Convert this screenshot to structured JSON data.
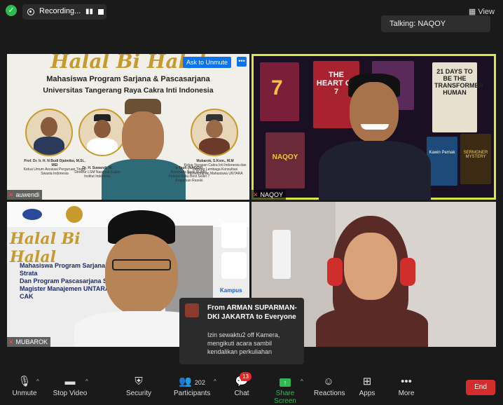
{
  "top": {
    "recording_label": "Recording...",
    "view_label": "View",
    "talking": "Talking: NAQOY"
  },
  "tiles": [
    {
      "name": "auwendi",
      "banner_title": "Halal Bi Halal",
      "subtitle_1": "Mahasiswa Program Sarjana & Pascasarjana",
      "subtitle_2": "Universitas Tangerang Raya Cakra Inti Indonesia",
      "ask_unmute": "Ask to Unmute",
      "more": "•••",
      "speakers": [
        {
          "name": "Prof. Dr. Ir. H. N Budi Djatmiko, M.Si., MEI",
          "desc": "Ketua Umum Asosiasi Perguruan Tinggi Swasta Indonesia"
        },
        {
          "name": "Dr. H. Suwandi, M.",
          "desc": "Direktur LSM Nasional Kajian Institut Indonesia"
        },
        {
          "name": "n Taufi (NAQOY)",
          "desc": "Komisaris Bank BUMN, Penulis Buku Best Seller 7 Keajaiban Rezeki"
        },
        {
          "name": "Mubarok, S.Kom., M.M",
          "desc": "Ketua Yayasan Cakra Inti Indonesia dan Direktur Lembaga Konsultasi Pemerintahan Mahasiswa UNTARA"
        }
      ]
    },
    {
      "name": "NAQOY",
      "books": [
        "7",
        "THE HEART OF 7",
        "21 DAYS TO BE THE TRANSFORMER HUMAN",
        "NAQOY",
        "Kawin Pernak",
        "SERMONER MYSTERY"
      ]
    },
    {
      "name": "MUBAROK",
      "banner_title": "Halal Bi Halal",
      "lines": [
        "Mahasiswa Program Sarjana Strata",
        "Dan Program Pascasarjana Strata",
        "Magister Manajemen UNTARA-CAK"
      ],
      "kampus": "Kampus"
    },
    {
      "name": ""
    }
  ],
  "chat": {
    "from": "From ARMAN SUPARMAN-DKI JAKARTA to Everyone",
    "message": "Izin sewaktu2 off Kamera, mengikuti acara sambil kendalikan perkuliahan"
  },
  "toolbar": {
    "unmute": "Unmute",
    "stop_video": "Stop Video",
    "security": "Security",
    "participants": "Participants",
    "participants_count": "202",
    "chat": "Chat",
    "chat_badge": "13",
    "share_screen": "Share Screen",
    "reactions": "Reactions",
    "apps": "Apps",
    "more": "More",
    "end": "End"
  },
  "colors": {
    "active_speaker": "#d8e64a",
    "share_green": "#2dbb4f",
    "end_red": "#d42d2d",
    "zoom_blue": "#0e72ed"
  }
}
